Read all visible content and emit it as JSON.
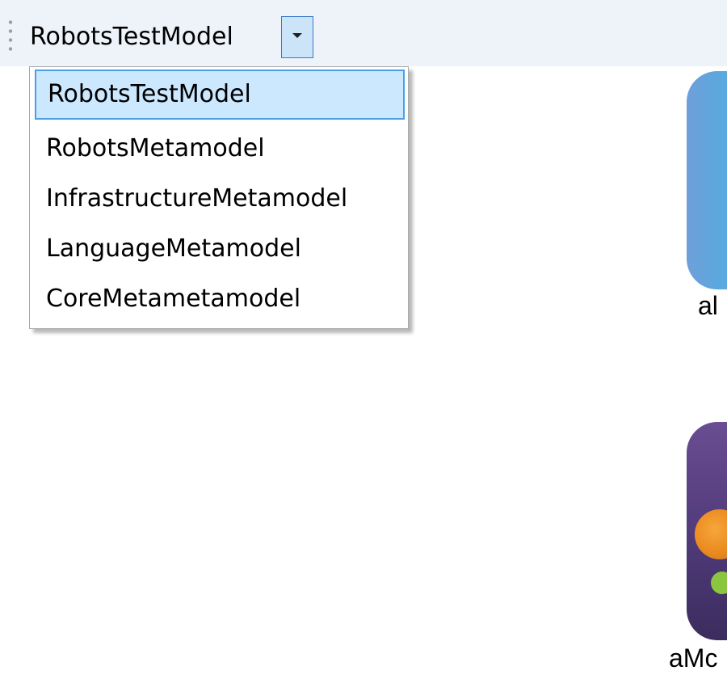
{
  "toolbar": {
    "combo": {
      "selected_value": "RobotsTestModel",
      "button_icon": "chevron-down-icon"
    }
  },
  "dropdown": {
    "items": [
      {
        "label": "RobotsTestModel"
      },
      {
        "label": "RobotsMetamodel"
      },
      {
        "label": "InfrastructureMetamodel"
      },
      {
        "label": "LanguageMetamodel"
      },
      {
        "label": "CoreMetametamodel"
      }
    ]
  },
  "canvas": {
    "nodes": [
      {
        "label": "al",
        "icon": "blue-robot-node-icon"
      },
      {
        "label": "aMc",
        "icon": "purple-robot-node-icon"
      }
    ]
  },
  "colors": {
    "toolbar_background": "#eef3fa",
    "selected_item_background": "#cce8ff",
    "selected_item_border": "#4a9fe6",
    "combo_button_background": "#cce4f7",
    "combo_button_border": "#3a78c9"
  }
}
